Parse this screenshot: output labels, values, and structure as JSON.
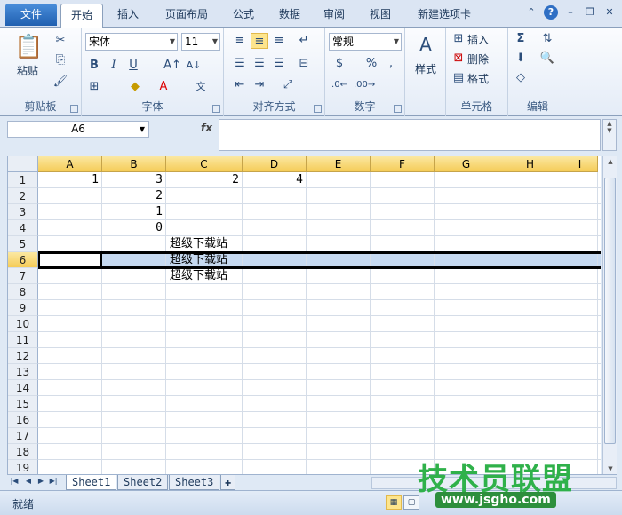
{
  "ribbon_tabs": {
    "file": "文件",
    "tabs": [
      "开始",
      "插入",
      "页面布局",
      "公式",
      "数据",
      "审阅",
      "视图",
      "新建选项卡"
    ]
  },
  "clipboard": {
    "paste": "粘贴",
    "label": "剪贴板"
  },
  "font": {
    "name": "宋体",
    "size": "11",
    "label": "字体",
    "bold": "B",
    "italic": "I",
    "underline": "U"
  },
  "alignment": {
    "label": "对齐方式"
  },
  "number": {
    "format": "常规",
    "label": "数字",
    "percent": "%"
  },
  "styles": {
    "label": "样式"
  },
  "cells": {
    "insert": "插入",
    "delete": "删除",
    "format": "格式",
    "label": "单元格"
  },
  "editing": {
    "label": "编辑"
  },
  "formula_bar": {
    "name_box": "A6",
    "fx": "fx"
  },
  "columns": [
    "A",
    "B",
    "C",
    "D",
    "E",
    "F",
    "G",
    "H",
    "I"
  ],
  "rows": [
    "1",
    "2",
    "3",
    "4",
    "5",
    "6",
    "7",
    "8",
    "9",
    "10",
    "11",
    "12",
    "13",
    "14",
    "15",
    "16",
    "17",
    "18",
    "19"
  ],
  "cells_data": {
    "A1": "1",
    "B1": "3",
    "C1": "2",
    "D1": "4",
    "B2": "2",
    "B3": "1",
    "B4": "0",
    "C5": "超级下载站",
    "C6": "超级下载站",
    "C7": "超级下载站"
  },
  "sheet_tabs": [
    "Sheet1",
    "Sheet2",
    "Sheet3"
  ],
  "status": {
    "ready": "就绪"
  },
  "watermark": {
    "text": "技术员联盟",
    "url": "www.jsgho.com"
  },
  "colors": {
    "accent": "#2b5797",
    "header_selected": "#f5cc58",
    "row_selected": "#c6d9f0"
  }
}
